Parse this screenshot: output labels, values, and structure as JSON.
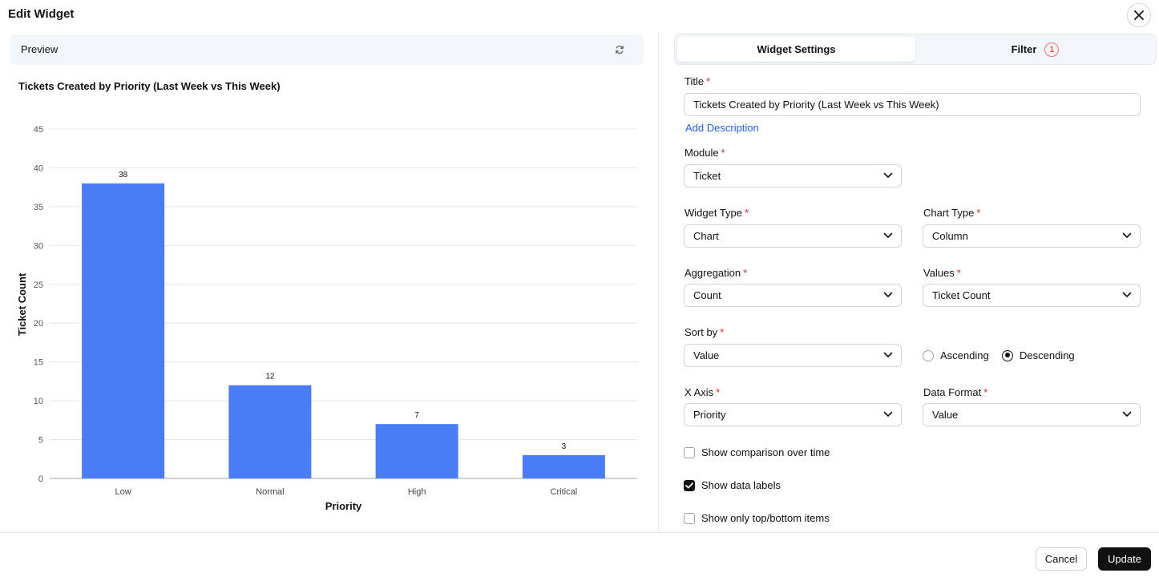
{
  "header": {
    "title": "Edit Widget"
  },
  "preview": {
    "label": "Preview"
  },
  "tabs": {
    "settings": "Widget Settings",
    "filter": "Filter",
    "filter_count": "1"
  },
  "form": {
    "title_label": "Title",
    "title_value": "Tickets Created by Priority (Last Week vs This Week)",
    "add_description": "Add Description",
    "module_label": "Module",
    "module_value": "Ticket",
    "widget_type_label": "Widget Type",
    "widget_type_value": "Chart",
    "chart_type_label": "Chart Type",
    "chart_type_value": "Column",
    "aggregation_label": "Aggregation",
    "aggregation_value": "Count",
    "values_label": "Values",
    "values_value": "Ticket Count",
    "sort_by_label": "Sort by",
    "sort_by_value": "Value",
    "ascending": "Ascending",
    "descending": "Descending",
    "sort_direction": "Descending",
    "x_axis_label": "X Axis",
    "x_axis_value": "Priority",
    "data_format_label": "Data Format",
    "data_format_value": "Value",
    "show_comparison": "Show comparison over time",
    "show_comparison_checked": false,
    "show_data_labels": "Show data labels",
    "show_data_labels_checked": true,
    "show_top_bottom": "Show only top/bottom items",
    "show_top_bottom_checked": false
  },
  "footer": {
    "cancel": "Cancel",
    "update": "Update"
  },
  "colors": {
    "bar": "#4a7cf5",
    "primary": "#111111",
    "required": "#dc2626",
    "link": "#2563eb"
  },
  "icons": {
    "close": "close-icon",
    "refresh": "refresh-icon",
    "chevron": "chevron-down-icon",
    "check": "check-icon"
  },
  "chart_data": {
    "type": "bar",
    "title": "Tickets Created by Priority (Last Week vs This Week)",
    "categories": [
      "Low",
      "Normal",
      "High",
      "Critical"
    ],
    "values": [
      38,
      12,
      7,
      3
    ],
    "data_labels": [
      "38",
      "12",
      "7",
      "3"
    ],
    "xlabel": "Priority",
    "ylabel": "Ticket Count",
    "ylim": [
      0,
      45
    ],
    "yticks": [
      "0",
      "5",
      "10",
      "15",
      "20",
      "25",
      "30",
      "35",
      "40",
      "45"
    ],
    "grid": true,
    "legend": "none"
  }
}
